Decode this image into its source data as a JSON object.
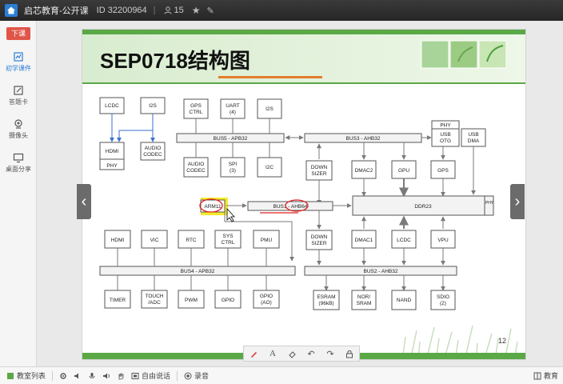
{
  "window": {
    "app_name": "启芯教育-公开课",
    "room_id": "ID 32200964",
    "participants": "15"
  },
  "sidebar": {
    "end_button": "下课",
    "items": [
      {
        "label": "初学课件"
      },
      {
        "label": "答题卡"
      },
      {
        "label": "摄像头"
      },
      {
        "label": "桌面分享"
      }
    ]
  },
  "slide": {
    "title": "SEP0718结构图",
    "page_number": "12",
    "blocks": {
      "lcdc_top": "LCDC",
      "i2s_top": "I2S",
      "hdmi_top": "HDMI",
      "hdmi_top_phy": "PHY",
      "audio_codec_top": [
        "AUDIO",
        "CODEC"
      ],
      "gps_ctrl": [
        "GPS",
        "CTRL"
      ],
      "uart": [
        "UART",
        "(4)"
      ],
      "i2s_mid": "I2S",
      "bus5": "BUS5 - APB32",
      "audio_codec_mid": [
        "AUDIO",
        "CODEC"
      ],
      "spi": [
        "SPI",
        "(3)"
      ],
      "i2c": "I2C",
      "phy_usb": "PHY",
      "usb_otg": [
        "USB",
        "OTG"
      ],
      "usb_dma": [
        "USB",
        "DMA"
      ],
      "bus3": "BUS3 - AHB32",
      "down_sizer_top": [
        "DOWN",
        "SIZER"
      ],
      "dmac2": "DMAC2",
      "gpu": "GPU",
      "gps": "GPS",
      "arm11": "ARM11",
      "bus1": "BUS1 - AHB64",
      "ddr23": "DDR23",
      "ddr_phy": "PHY",
      "hdmi_bot": "HDMI",
      "vic": "VIC",
      "rtc": "RTC",
      "sys_ctrl": [
        "SYS",
        "CTRL"
      ],
      "pmu": "PMU",
      "down_sizer_bot": [
        "DOWN",
        "SIZER"
      ],
      "dmac1": "DMAC1",
      "lcdc_bot": "LCDC",
      "vpu": "VPU",
      "bus4": "BUS4 - APB32",
      "bus2": "BUS2 - AHB32",
      "timer": "TIMER",
      "touch_adc": [
        "TOUCH",
        "/ADC"
      ],
      "pwm": "PWM",
      "gpio": "GPIO",
      "gpio_ao": [
        "GPIO",
        "(AO)"
      ],
      "esram": [
        "ESRAM",
        "(96kB)"
      ],
      "nor_sram": [
        "NOR/",
        "SRAM"
      ],
      "nand": "NAND",
      "sdio": [
        "SDIO",
        "(2)"
      ]
    }
  },
  "bottombar": {
    "student_list": "教室列表",
    "free_talk": "自由说话",
    "record": "录音",
    "right_label": "教育"
  },
  "colors": {
    "accent": "#2a7fd4",
    "end_button": "#e05548",
    "title_green": "#3f9b3a",
    "highlight_yellow": "#f5ea2b",
    "annotation_red": "#e02020"
  }
}
